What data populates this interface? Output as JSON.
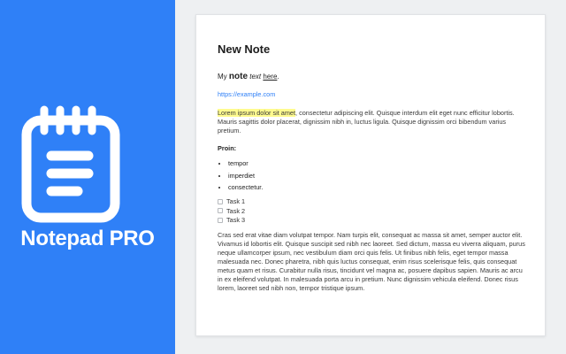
{
  "brand": {
    "name": "Notepad PRO",
    "icon": "notepad-icon",
    "color": "#2f80f7"
  },
  "note": {
    "title": "New Note",
    "line1": {
      "prefix": "My ",
      "bold": "note",
      "space": " ",
      "italic": "text",
      "space2": " ",
      "underline": "here",
      "suffix": "."
    },
    "link": "https://example.com",
    "para1": {
      "highlight": "Lorem ipsum dolor sit amet",
      "rest": ", consectetur adipiscing elit. Quisque interdum elit eget nunc efficitur lobortis. Mauris sagittis dolor placerat, dignissim nibh in, luctus ligula. Quisque dignissim orci bibendum varius pretium."
    },
    "subheading": "Proin:",
    "bullets": [
      "tempor",
      "imperdiet",
      "consectetur."
    ],
    "tasks": [
      "Task 1",
      "Task 2",
      "Task 3"
    ],
    "para2": "Cras sed erat vitae diam volutpat tempor. Nam turpis elit, consequat ac massa sit amet, semper auctor elit. Vivamus id lobortis elit. Quisque suscipit sed nibh nec laoreet. Sed dictum, massa eu viverra aliquam, purus neque ullamcorper ipsum, nec vestibulum diam orci quis felis. Ut finibus nibh felis, eget tempor massa malesuada nec. Donec pharetra, nibh quis luctus consequat, enim risus scelerisque felis, quis consequat metus quam et risus. Curabitur nulla risus, tincidunt vel magna ac, posuere dapibus sapien. Mauris ac arcu in ex eleifend volutpat. In malesuada porta arcu in pretium. Nunc dignissim vehicula eleifend. Donec risus lorem, laoreet sed nibh non, tempor tristique ipsum."
  },
  "colors": {
    "highlight": "#fffb8f",
    "link": "#2f80f7",
    "page_bg": "#eef0f2"
  }
}
